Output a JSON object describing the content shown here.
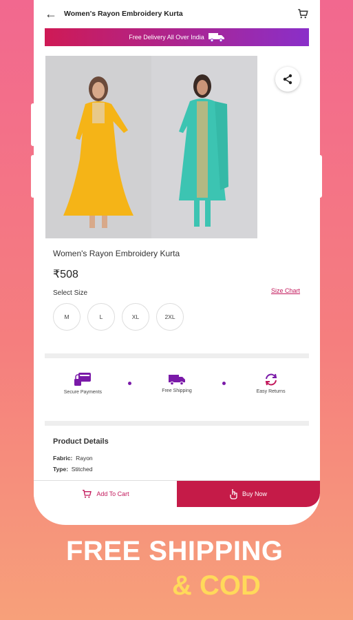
{
  "header": {
    "title": "Women's Rayon Embroidery Kurta"
  },
  "banner": {
    "text": "Free Delivery All Over India"
  },
  "product": {
    "name": "Women's Rayon Embroidery Kurta",
    "price": "₹508",
    "select_size_label": "Select Size",
    "size_chart_label": "Size Chart",
    "sizes": [
      "M",
      "L",
      "XL",
      "2XL"
    ]
  },
  "features": [
    {
      "label": "Secure Payments",
      "icon": "secure-payment-icon"
    },
    {
      "label": "Free Shipping",
      "icon": "delivery-truck-icon"
    },
    {
      "label": "Easy Returns",
      "icon": "return-arrows-icon"
    }
  ],
  "details": {
    "title": "Product Details",
    "rows": [
      {
        "key": "Fabric:",
        "value": "Rayon"
      },
      {
        "key": "Type:",
        "value": "Stitched"
      }
    ]
  },
  "actions": {
    "add_to_cart": "Add To Cart",
    "buy_now": "Buy Now"
  },
  "promo": {
    "line1": "FREE SHIPPING",
    "line2": "& COD"
  },
  "colors": {
    "accent": "#c51b48",
    "banner_start": "#cf1a55",
    "banner_end": "#8a2fc9",
    "promo_yellow": "#ffd95a"
  }
}
